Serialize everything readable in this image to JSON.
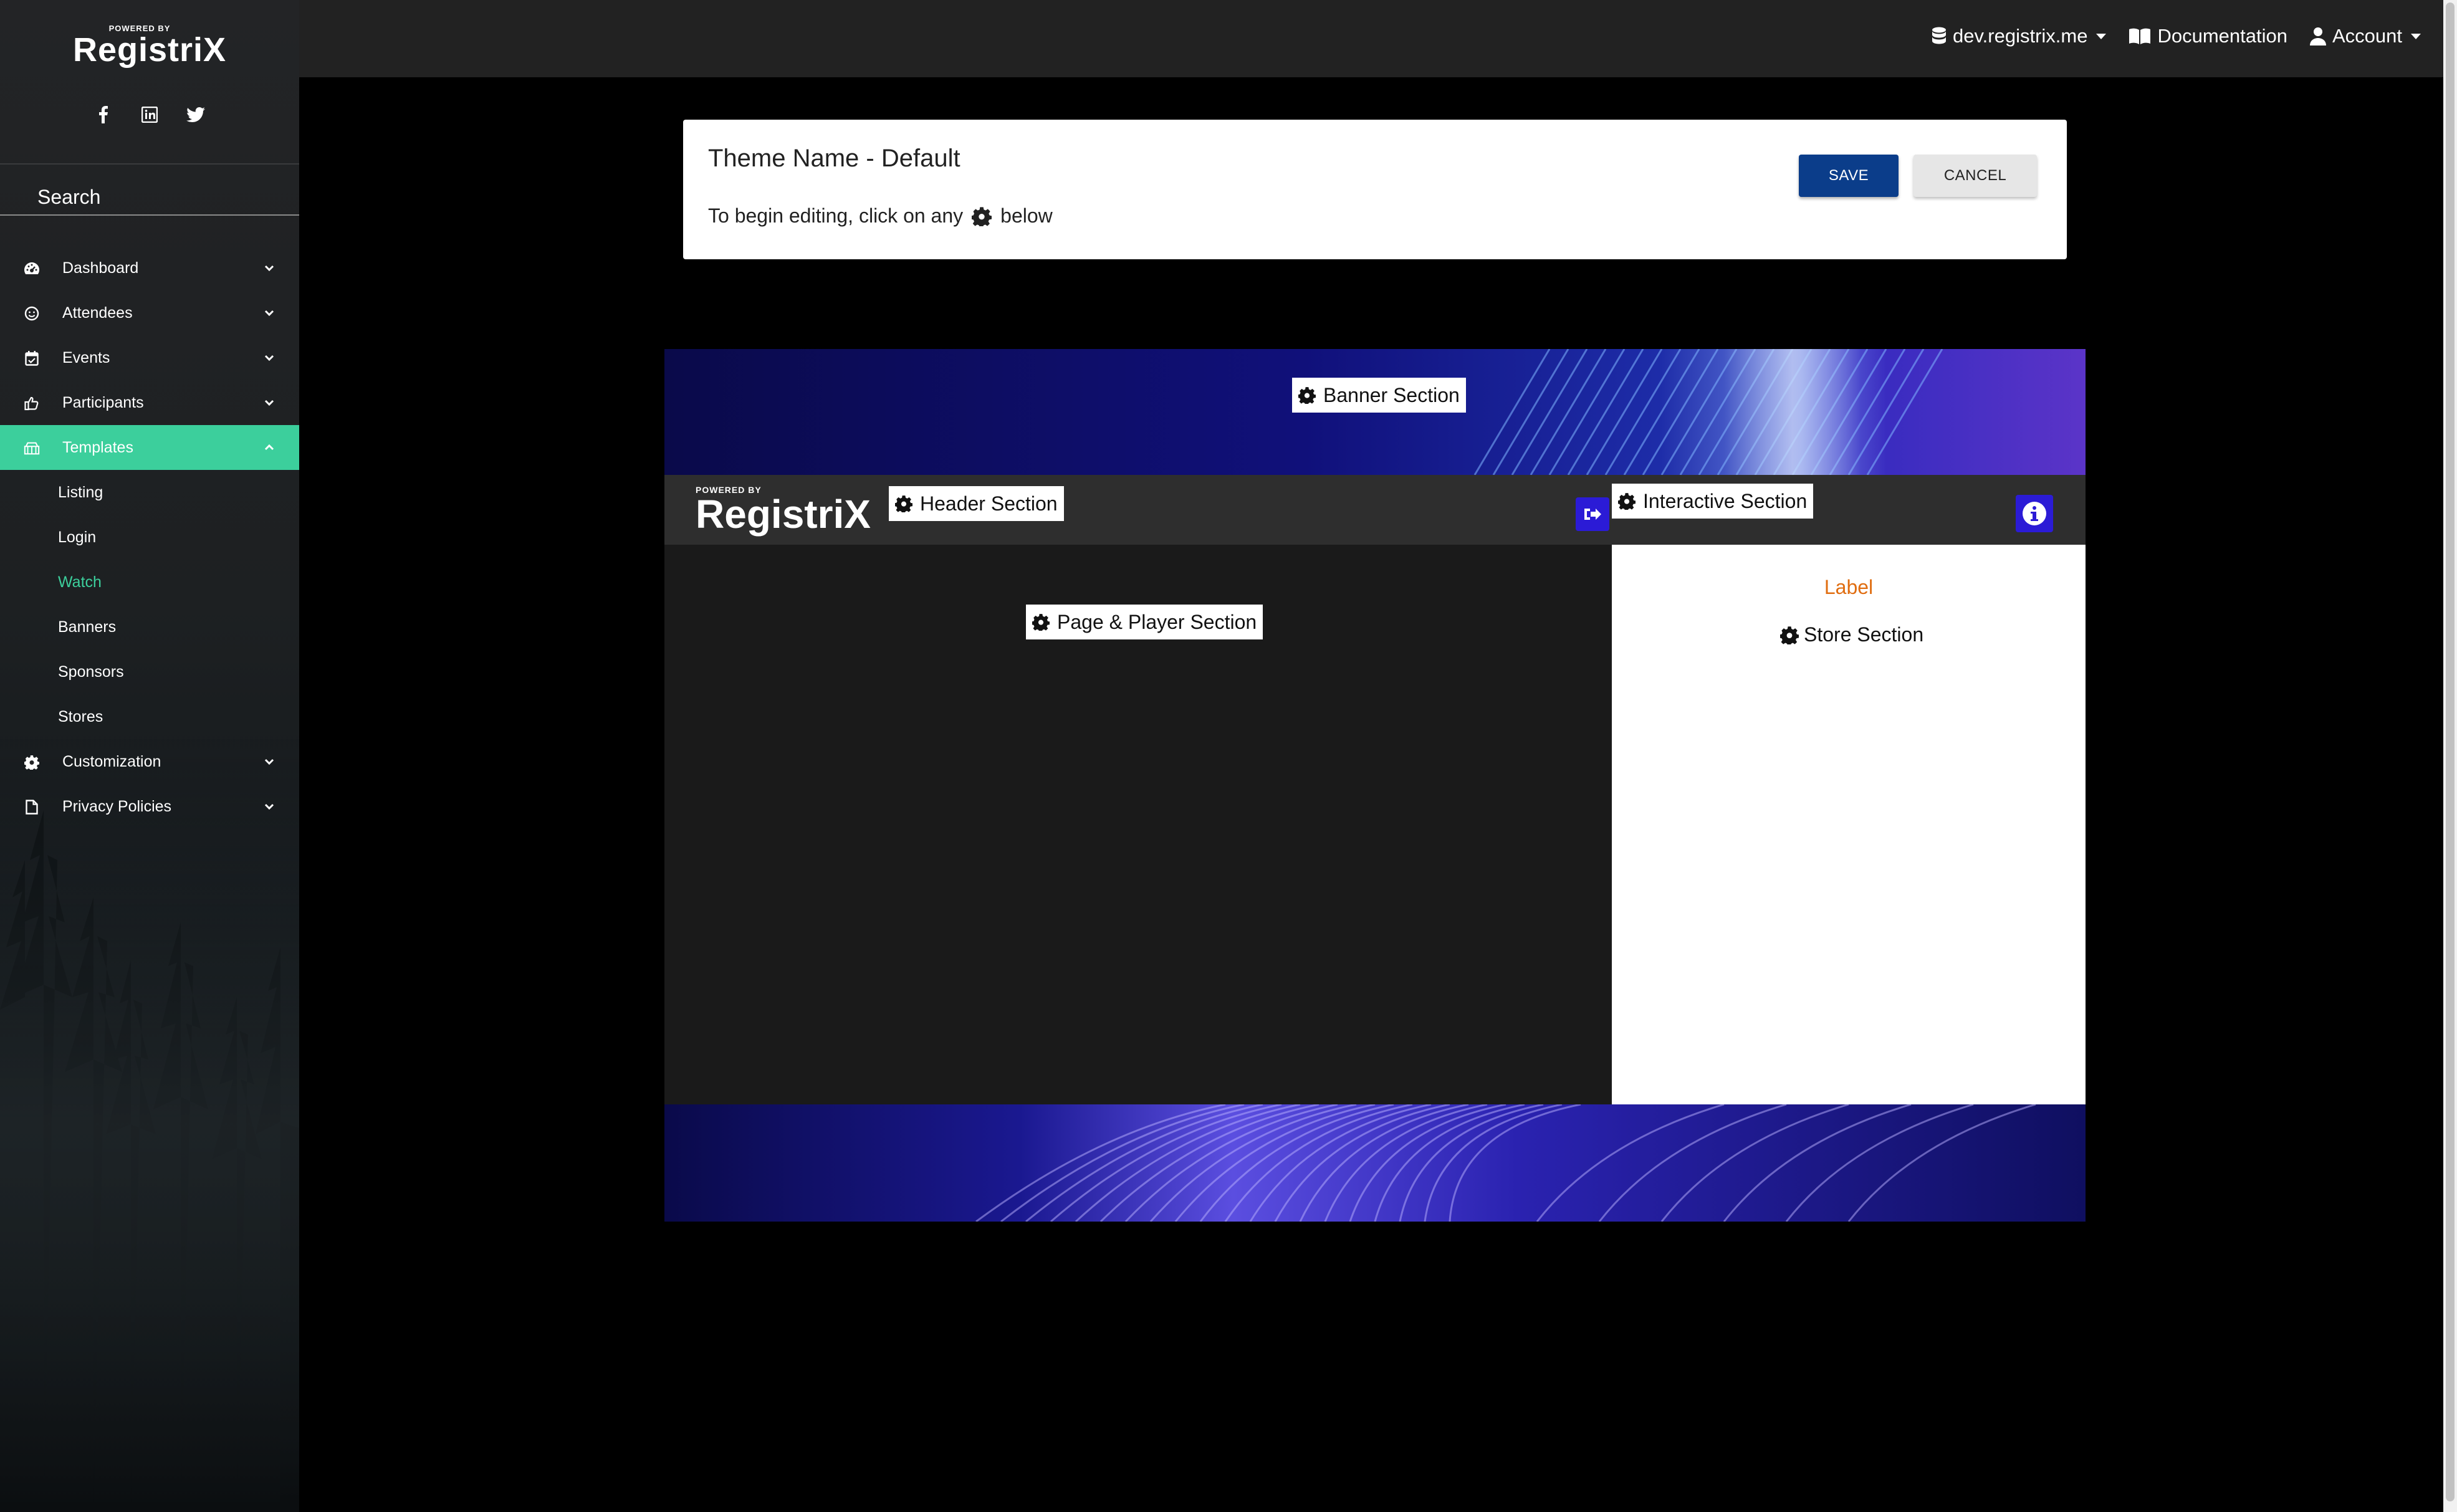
{
  "sidebar": {
    "brand": {
      "powered": "POWERED BY",
      "name": "RegistriX"
    },
    "socials": [
      "facebook-icon",
      "linkedin-icon",
      "twitter-icon"
    ],
    "search": {
      "placeholder": "Search",
      "value": ""
    },
    "items": [
      {
        "label": "Dashboard",
        "icon": "dashboard-icon",
        "expanded": false
      },
      {
        "label": "Attendees",
        "icon": "attendees-icon",
        "expanded": false
      },
      {
        "label": "Events",
        "icon": "calendar-icon",
        "expanded": false
      },
      {
        "label": "Participants",
        "icon": "thumbs-up-icon",
        "expanded": false
      },
      {
        "label": "Templates",
        "icon": "templates-icon",
        "expanded": true,
        "children": [
          "Listing",
          "Login",
          "Watch",
          "Banners",
          "Sponsors",
          "Stores"
        ],
        "current": "Watch"
      },
      {
        "label": "Customization",
        "icon": "gear-icon",
        "expanded": false
      },
      {
        "label": "Privacy Policies",
        "icon": "document-icon",
        "expanded": false
      }
    ],
    "accent": "#3ccf9c"
  },
  "topbar": {
    "environment": "dev.registrix.me",
    "documentation": "Documentation",
    "account": "Account"
  },
  "editor": {
    "title": "Theme Name - Default",
    "hint_before": "To begin editing, click on any",
    "hint_after": "below",
    "save_label": "SAVE",
    "cancel_label": "CANCEL",
    "save_color": "#0b3d8a"
  },
  "preview": {
    "banner_section": "Banner Section",
    "header_section": "Header Section",
    "interactive_section": "Interactive Section",
    "page_player_section": "Page & Player Section",
    "store_label": "Label",
    "store_section": "Store Section",
    "logo_powered": "POWERED BY",
    "logo_name": "RegistriX",
    "button_color": "#2b1bd6",
    "label_color": "#e06d10"
  }
}
